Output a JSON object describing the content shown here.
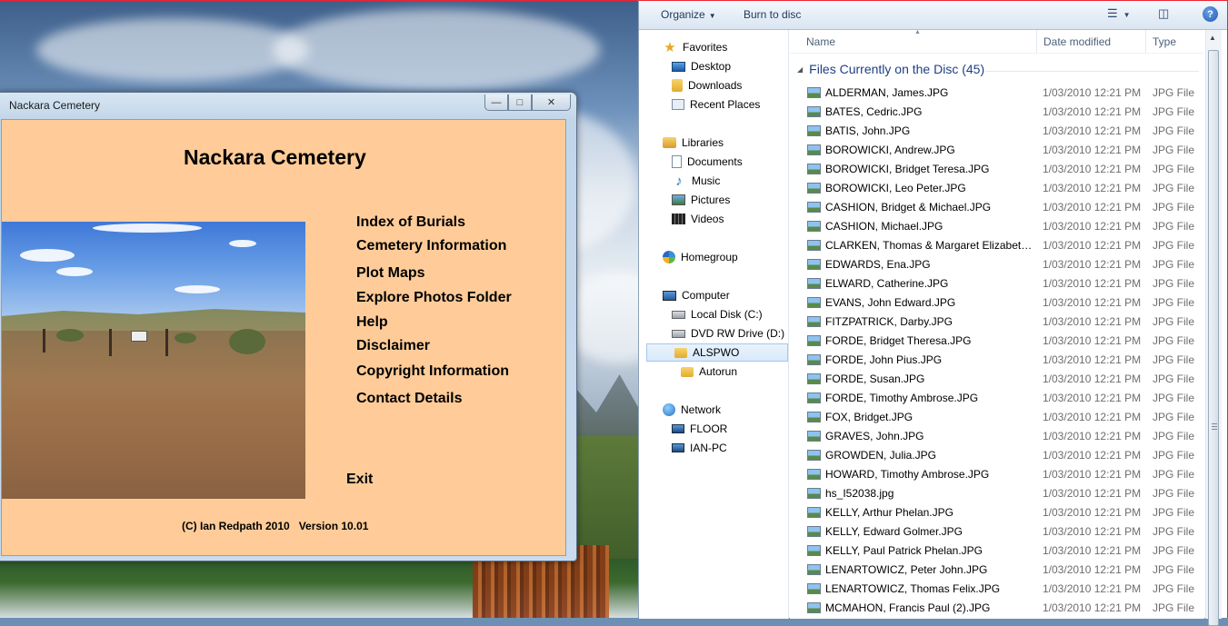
{
  "app": {
    "window_title": "Nackara Cemetery",
    "heading": "Nackara Cemetery",
    "menu": [
      "Index of Burials",
      "Cemetery Information",
      "Plot Maps",
      "Explore Photos Folder",
      "Help",
      "Disclaimer",
      "Copyright Information",
      "Contact Details"
    ],
    "exit_label": "Exit",
    "footer": "(C) Ian Redpath 2010   Version 10.01",
    "background_color": "#ffcc99"
  },
  "explorer": {
    "toolbar": {
      "organize": "Organize",
      "burn": "Burn to disc",
      "help": "?"
    },
    "nav": {
      "favorites": "Favorites",
      "desktop": "Desktop",
      "downloads": "Downloads",
      "recent": "Recent Places",
      "libraries": "Libraries",
      "documents": "Documents",
      "music": "Music",
      "pictures": "Pictures",
      "videos": "Videos",
      "homegroup": "Homegroup",
      "computer": "Computer",
      "local_disk": "Local Disk (C:)",
      "dvd": "DVD RW Drive (D:) M",
      "alspwo": "ALSPWO",
      "autorun": "Autorun",
      "network": "Network",
      "floor": "FLOOR",
      "ian_pc": "IAN-PC"
    },
    "columns": {
      "name": "Name",
      "date": "Date modified",
      "type": "Type"
    },
    "group": "Files Currently on the Disc (45)",
    "files": [
      {
        "name": "ALDERMAN, James.JPG",
        "date": "1/03/2010 12:21 PM",
        "type": "JPG File"
      },
      {
        "name": "BATES, Cedric.JPG",
        "date": "1/03/2010 12:21 PM",
        "type": "JPG File"
      },
      {
        "name": "BATIS, John.JPG",
        "date": "1/03/2010 12:21 PM",
        "type": "JPG File"
      },
      {
        "name": "BOROWICKI, Andrew.JPG",
        "date": "1/03/2010 12:21 PM",
        "type": "JPG File"
      },
      {
        "name": "BOROWICKI, Bridget Teresa.JPG",
        "date": "1/03/2010 12:21 PM",
        "type": "JPG File"
      },
      {
        "name": "BOROWICKI, Leo Peter.JPG",
        "date": "1/03/2010 12:21 PM",
        "type": "JPG File"
      },
      {
        "name": "CASHION, Bridget & Michael.JPG",
        "date": "1/03/2010 12:21 PM",
        "type": "JPG File"
      },
      {
        "name": "CASHION, Michael.JPG",
        "date": "1/03/2010 12:21 PM",
        "type": "JPG File"
      },
      {
        "name": "CLARKEN, Thomas & Margaret Elizabeth....",
        "date": "1/03/2010 12:21 PM",
        "type": "JPG File"
      },
      {
        "name": "EDWARDS, Ena.JPG",
        "date": "1/03/2010 12:21 PM",
        "type": "JPG File"
      },
      {
        "name": "ELWARD, Catherine.JPG",
        "date": "1/03/2010 12:21 PM",
        "type": "JPG File"
      },
      {
        "name": "EVANS, John Edward.JPG",
        "date": "1/03/2010 12:21 PM",
        "type": "JPG File"
      },
      {
        "name": "FITZPATRICK, Darby.JPG",
        "date": "1/03/2010 12:21 PM",
        "type": "JPG File"
      },
      {
        "name": "FORDE, Bridget Theresa.JPG",
        "date": "1/03/2010 12:21 PM",
        "type": "JPG File"
      },
      {
        "name": "FORDE, John Pius.JPG",
        "date": "1/03/2010 12:21 PM",
        "type": "JPG File"
      },
      {
        "name": "FORDE, Susan.JPG",
        "date": "1/03/2010 12:21 PM",
        "type": "JPG File"
      },
      {
        "name": "FORDE, Timothy Ambrose.JPG",
        "date": "1/03/2010 12:21 PM",
        "type": "JPG File"
      },
      {
        "name": "FOX, Bridget.JPG",
        "date": "1/03/2010 12:21 PM",
        "type": "JPG File"
      },
      {
        "name": "GRAVES, John.JPG",
        "date": "1/03/2010 12:21 PM",
        "type": "JPG File"
      },
      {
        "name": "GROWDEN, Julia.JPG",
        "date": "1/03/2010 12:21 PM",
        "type": "JPG File"
      },
      {
        "name": "HOWARD, Timothy Ambrose.JPG",
        "date": "1/03/2010 12:21 PM",
        "type": "JPG File"
      },
      {
        "name": "hs_I52038.jpg",
        "date": "1/03/2010 12:21 PM",
        "type": "JPG File"
      },
      {
        "name": "KELLY, Arthur Phelan.JPG",
        "date": "1/03/2010 12:21 PM",
        "type": "JPG File"
      },
      {
        "name": "KELLY, Edward Golmer.JPG",
        "date": "1/03/2010 12:21 PM",
        "type": "JPG File"
      },
      {
        "name": "KELLY, Paul Patrick Phelan.JPG",
        "date": "1/03/2010 12:21 PM",
        "type": "JPG File"
      },
      {
        "name": "LENARTOWICZ, Peter John.JPG",
        "date": "1/03/2010 12:21 PM",
        "type": "JPG File"
      },
      {
        "name": "LENARTOWICZ, Thomas Felix.JPG",
        "date": "1/03/2010 12:21 PM",
        "type": "JPG File"
      },
      {
        "name": "MCMAHON, Francis Paul (2).JPG",
        "date": "1/03/2010 12:21 PM",
        "type": "JPG File"
      }
    ]
  }
}
